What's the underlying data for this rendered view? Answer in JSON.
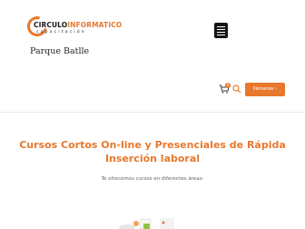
{
  "brand": {
    "logo_text_main": "CIRCULO",
    "logo_text_accent": "INFORMATICO",
    "logo_tagline": "capacitación",
    "location": "Parque Batlle"
  },
  "header": {
    "menu_icon": "hamburger-menu-icon",
    "cart_icon": "cart-icon",
    "cart_count": "0",
    "search_icon": "search-icon",
    "call_button_label": "llámanos ›"
  },
  "main": {
    "heading": "Cursos Cortos On-line y Presenciales de Rápida Inserción laboral",
    "subtitle": "Te ofrecemos cursos en diferentes áreas:"
  },
  "colors": {
    "accent": "#e8782c",
    "dark": "#151515"
  }
}
